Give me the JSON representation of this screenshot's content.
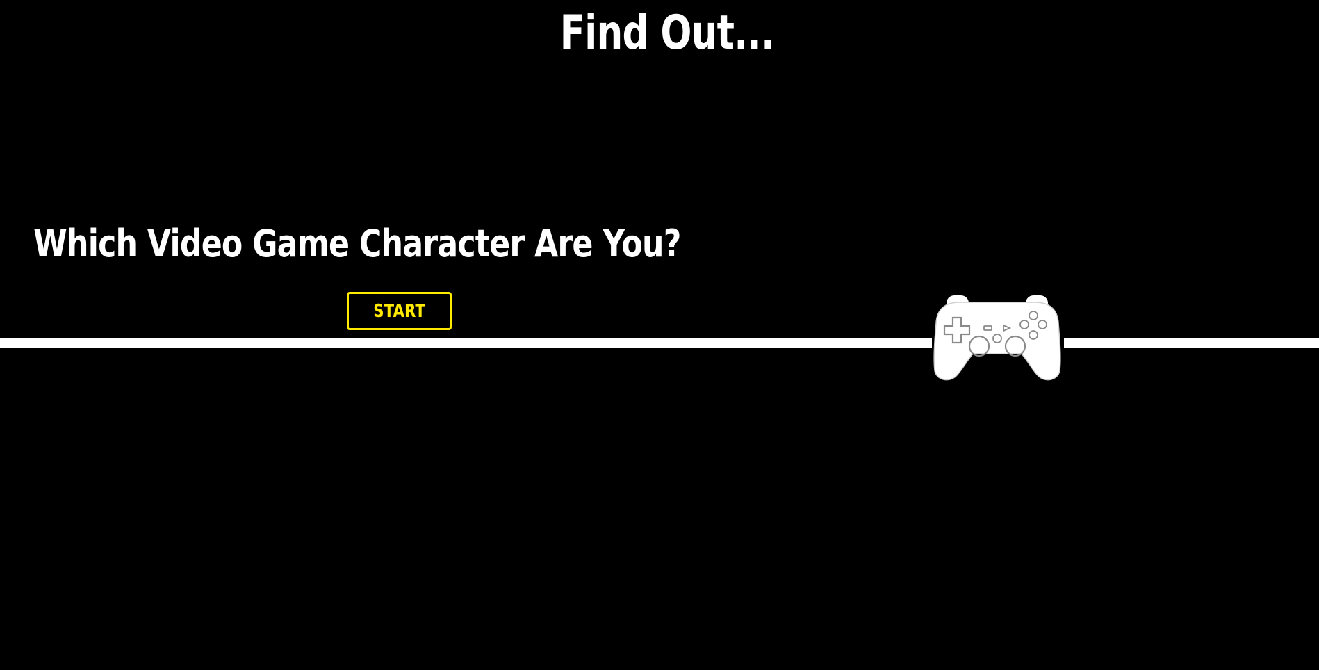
{
  "header": {
    "title": "Find Out..."
  },
  "hero": {
    "headline": "Which Video Game Character Are You?",
    "start_label": "START",
    "graphic_icon": "gamepad-icon"
  },
  "colors": {
    "background": "#000000",
    "text": "#ffffff",
    "accent": "#ffea00"
  }
}
